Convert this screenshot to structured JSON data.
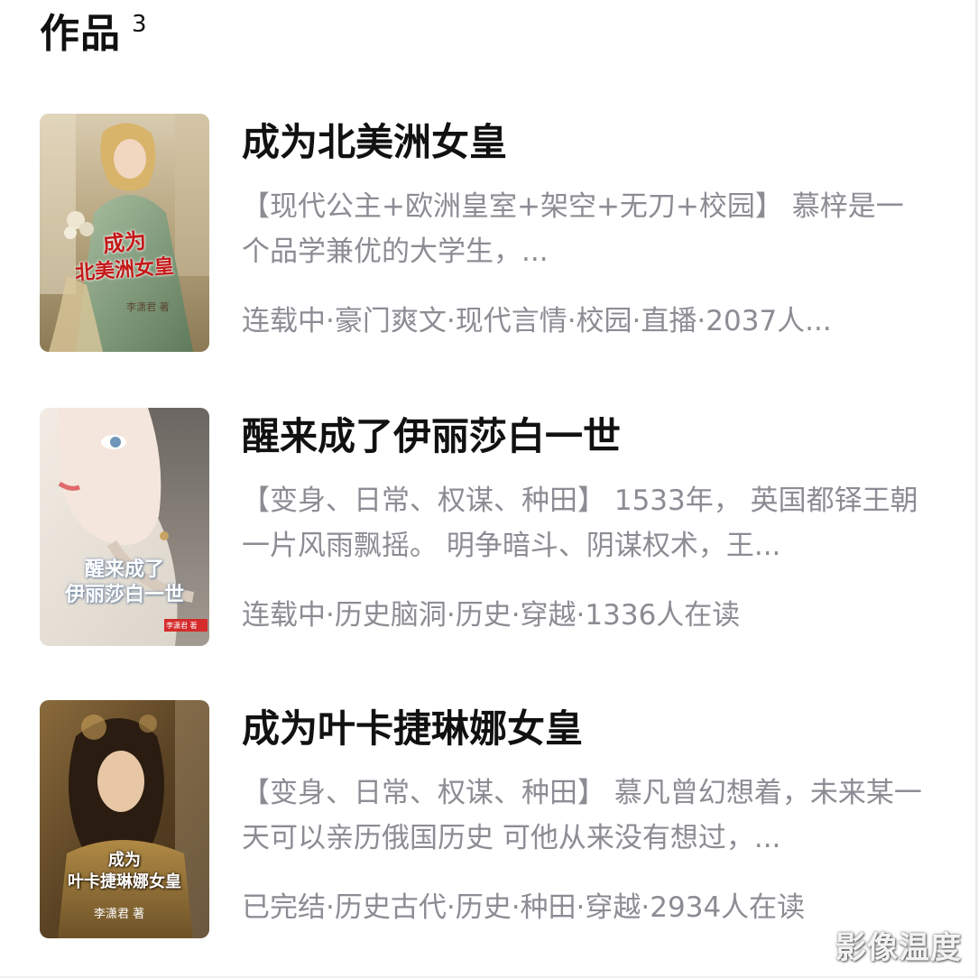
{
  "section": {
    "title": "作品",
    "count": "3"
  },
  "books": [
    {
      "title": "成为北美洲女皇",
      "description": "【现代公主+欧洲皇室+架空+无刀+校园】 慕梓是一个品学兼优的大学生，...",
      "meta": "连载中·豪门爽文·现代言情·校园·直播·2037人...",
      "cover_text": [
        "成为",
        "北美洲女皇"
      ],
      "cover_author": "李潇君 著"
    },
    {
      "title": "醒来成了伊丽莎白一世",
      "description": "【变身、日常、权谋、种田】 1533年， 英国都铎王朝一片风雨飘摇。 明争暗斗、阴谋权术，王...",
      "meta": "连载中·历史脑洞·历史·穿越·1336人在读",
      "cover_text": [
        "醒来成了",
        "伊丽莎白一世"
      ],
      "cover_author": "李潇君 著"
    },
    {
      "title": "成为叶卡捷琳娜女皇",
      "description": "【变身、日常、权谋、种田】 慕凡曾幻想着，未来某一天可以亲历俄国历史 可他从来没有想过，...",
      "meta": "已完结·历史古代·历史·种田·穿越·2934人在读",
      "cover_text": [
        "成为",
        "叶卡捷琳娜女皇"
      ],
      "cover_author": "李潇君 著"
    }
  ],
  "watermark": "影像温度",
  "colors": {
    "title": "#111111",
    "secondary_text": "#8c8c94",
    "cover1_title": "#c41818",
    "cover2_title": "#ffffff",
    "cover3_title": "#ffffff"
  }
}
